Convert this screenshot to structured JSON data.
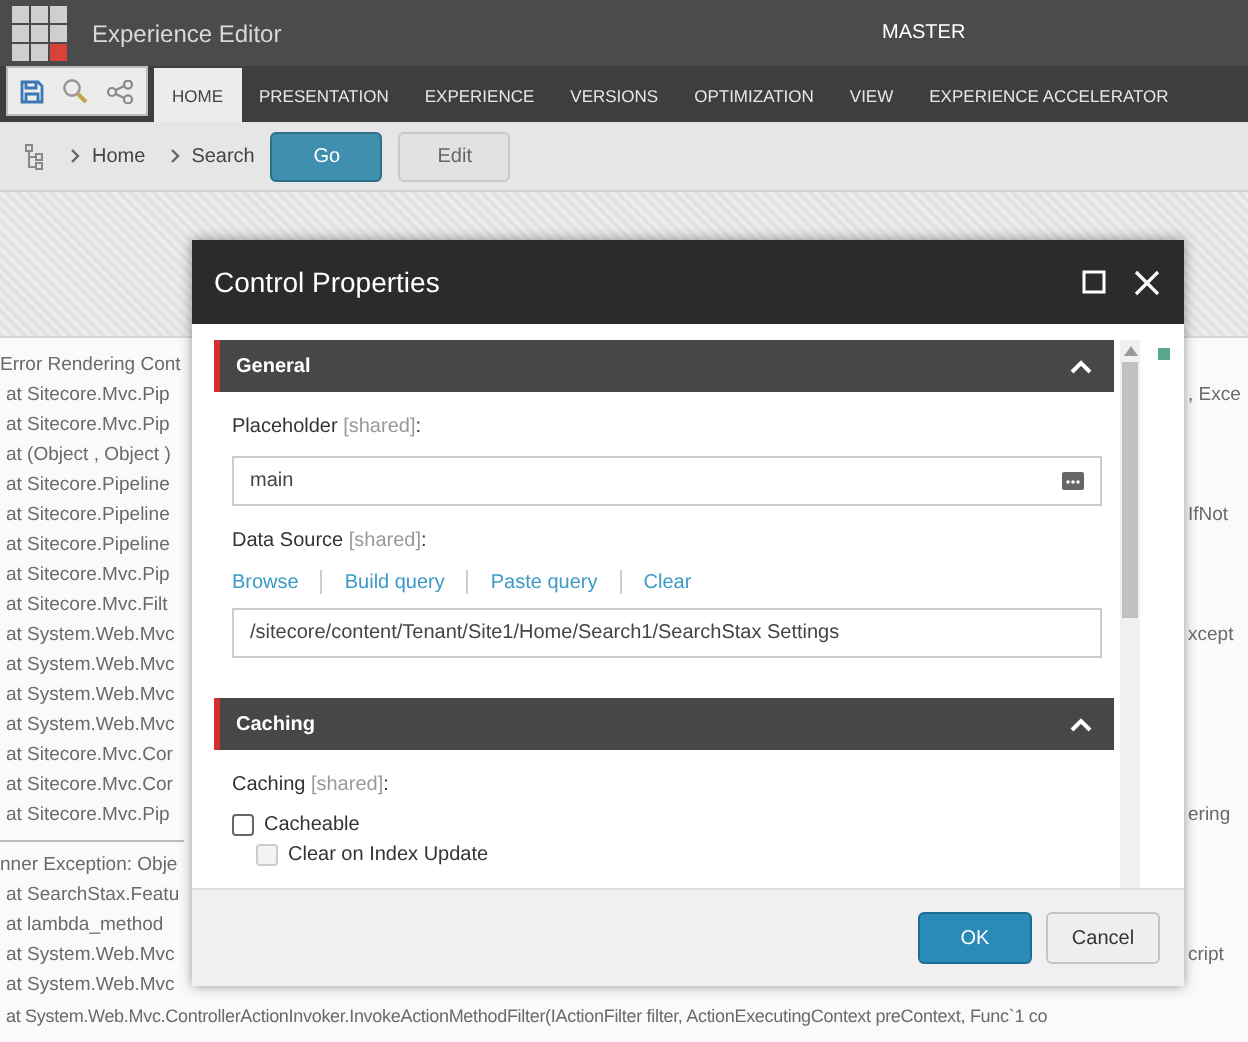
{
  "header": {
    "app_title": "Experience Editor",
    "database": "MASTER"
  },
  "ribbon": {
    "tabs": [
      {
        "label": "HOME",
        "selected": true
      },
      {
        "label": "PRESENTATION",
        "selected": false
      },
      {
        "label": "EXPERIENCE",
        "selected": false
      },
      {
        "label": "VERSIONS",
        "selected": false
      },
      {
        "label": "OPTIMIZATION",
        "selected": false
      },
      {
        "label": "VIEW",
        "selected": false
      },
      {
        "label": "EXPERIENCE ACCELERATOR",
        "selected": false
      }
    ]
  },
  "breadcrumb": {
    "items": [
      "Home",
      "Search"
    ],
    "buttons": [
      {
        "label": "Go",
        "kind": "primary"
      },
      {
        "label": "Edit",
        "kind": "secondary"
      }
    ]
  },
  "error_log": {
    "lines": [
      {
        "left": "Error Rendering Cont"
      },
      {
        "left": "at Sitecore.Mvc.Pip",
        "right": ", Exce"
      },
      {
        "left": "at Sitecore.Mvc.Pip"
      },
      {
        "left": "at (Object , Object )"
      },
      {
        "left": "at Sitecore.Pipeline"
      },
      {
        "left": "at Sitecore.Pipeline",
        "right": "IfNot"
      },
      {
        "left": "at Sitecore.Pipeline"
      },
      {
        "left": "at Sitecore.Mvc.Pip"
      },
      {
        "left": "at Sitecore.Mvc.Filt"
      },
      {
        "left": "at System.Web.Mvc",
        "right": "xcept"
      },
      {
        "left": "at System.Web.Mvc"
      },
      {
        "left": "at System.Web.Mvc"
      },
      {
        "left": "at System.Web.Mvc"
      },
      {
        "left": "at Sitecore.Mvc.Cor"
      },
      {
        "left": "at Sitecore.Mvc.Cor"
      },
      {
        "left": "at Sitecore.Mvc.Pip",
        "right": "ering"
      }
    ],
    "inner_lines": [
      {
        "left": "nner Exception: Obje"
      },
      {
        "left": "at SearchStax.Featu"
      },
      {
        "left": "at lambda_method"
      },
      {
        "left": "at System.Web.Mvc",
        "right": "cript"
      },
      {
        "left": "at System.Web.Mvc"
      }
    ],
    "last_line": "at System.Web.Mvc.ControllerActionInvoker.InvokeActionMethodFilter(IActionFilter filter, ActionExecutingContext preContext, Func`1 co"
  },
  "dialog": {
    "title": "Control Properties",
    "sections": [
      {
        "title": "General",
        "expanded": true,
        "fields": [
          {
            "kind": "text",
            "label": "Placeholder",
            "tag": "[shared]",
            "suffix": ":",
            "value": "main"
          },
          {
            "kind": "datasource",
            "label": "Data Source",
            "tag": "[shared]",
            "suffix": ":",
            "links": [
              "Browse",
              "Build query",
              "Paste query",
              "Clear"
            ],
            "value": "/sitecore/content/Tenant/Site1/Home/Search1/SearchStax Settings"
          }
        ]
      },
      {
        "title": "Caching",
        "expanded": true,
        "fields": [
          {
            "kind": "checks",
            "label": "Caching",
            "tag": "[shared]",
            "suffix": ":",
            "options": [
              {
                "label": "Cacheable",
                "checked": false,
                "disabled": false
              },
              {
                "label": "Clear on Index Update",
                "checked": false,
                "disabled": true
              }
            ]
          }
        ]
      }
    ],
    "buttons": [
      {
        "label": "OK",
        "kind": "primary"
      },
      {
        "label": "Cancel",
        "kind": "secondary"
      }
    ]
  }
}
